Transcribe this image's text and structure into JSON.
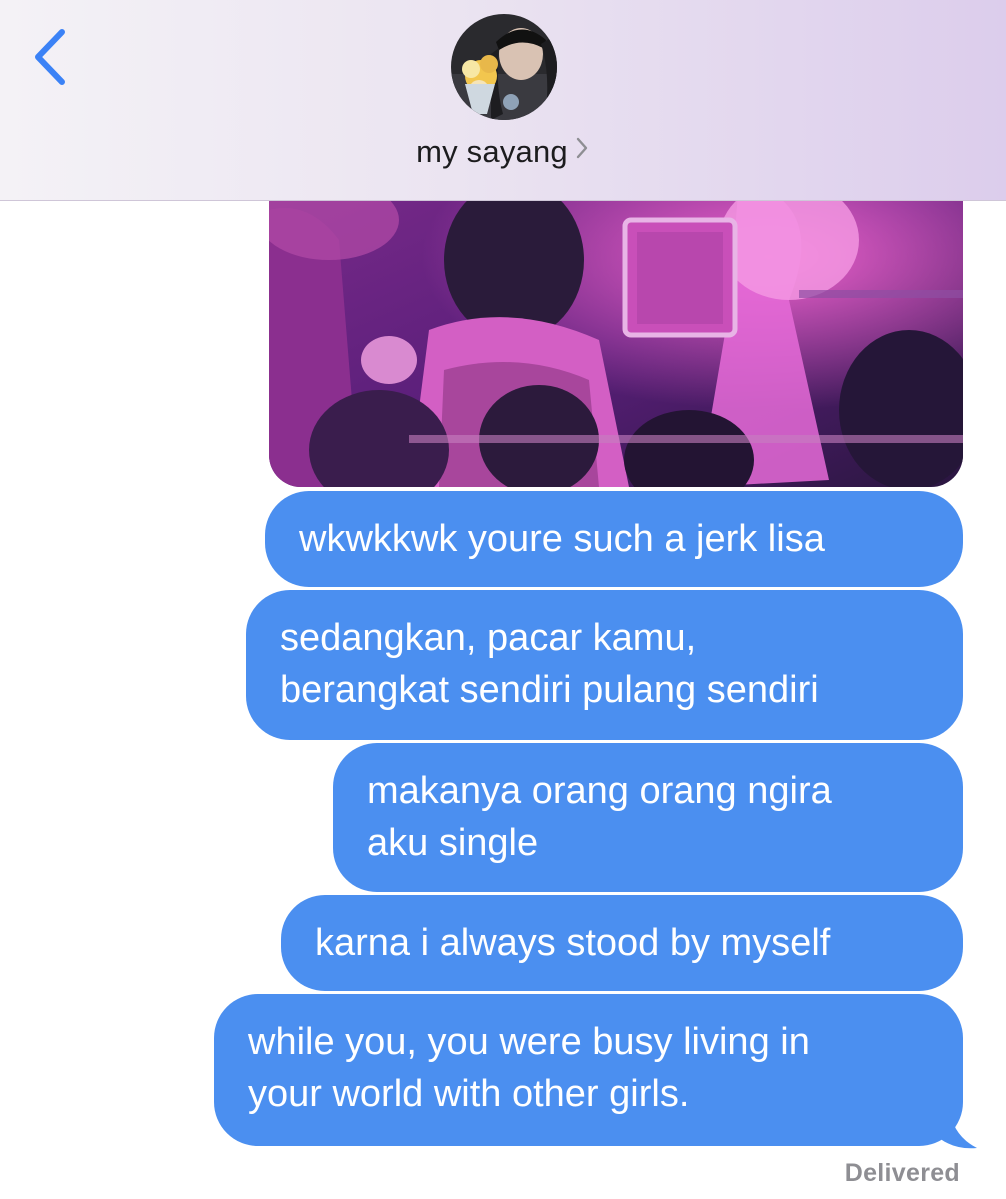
{
  "header": {
    "back_icon": "chevron-left-icon",
    "contact_name": "my sayang",
    "name_chevron_icon": "chevron-right-icon",
    "colors": {
      "accent": "#3b82f6",
      "gradient_left": "#f4f2f6",
      "gradient_right": "#dccdec"
    }
  },
  "conversation": {
    "photo_message": {
      "kind": "image",
      "description_icon": "photo-thumbnail"
    },
    "messages": [
      {
        "sender": "me",
        "lines": [
          "wkwkkwk youre such a jerk lisa"
        ]
      },
      {
        "sender": "me",
        "lines": [
          "sedangkan, pacar kamu,",
          "berangkat sendiri pulang sendiri"
        ]
      },
      {
        "sender": "me",
        "lines": [
          "makanya orang orang ngira",
          "aku single"
        ]
      },
      {
        "sender": "me",
        "lines": [
          "karna i always stood by myself"
        ]
      },
      {
        "sender": "me",
        "lines": [
          "while you, you were busy living in",
          "your world with other girls."
        ]
      }
    ],
    "status": "Delivered",
    "colors": {
      "bubble": "#4b8ff0",
      "bubble_text": "#ffffff",
      "status_text": "#8e8e93"
    }
  }
}
